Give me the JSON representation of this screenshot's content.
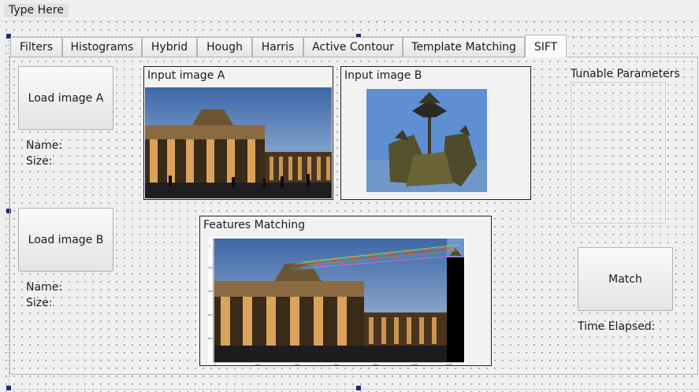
{
  "menubar": {
    "item": "Type Here"
  },
  "tabs": [
    "Filters",
    "Histograms",
    "Hybrid",
    "Hough",
    "Harris",
    "Active Contour",
    "Template Matching",
    "SIFT"
  ],
  "active_tab": "SIFT",
  "load_a": {
    "button": "Load image A",
    "name_label": "Name:",
    "size_label": "Size:"
  },
  "load_b": {
    "button": "Load image B",
    "name_label": "Name:",
    "size_label": "Size:"
  },
  "panels": {
    "input_a": "Input image A",
    "input_b": "Input image B",
    "features": "Features Matching"
  },
  "tunable": {
    "title": "Tunable Parameters"
  },
  "match": {
    "button": "Match",
    "time_label": "Time Elapsed:"
  }
}
